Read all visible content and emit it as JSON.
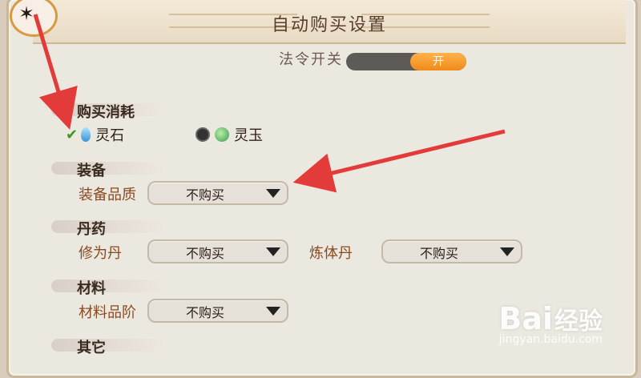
{
  "window": {
    "title": "自动购买设置"
  },
  "hidden_row": {
    "label": "法令开关",
    "toggle_text": "开"
  },
  "sections": {
    "consume": {
      "label": "购买消耗"
    },
    "equipment": {
      "label": "装备"
    },
    "pill": {
      "label": "丹药"
    },
    "material": {
      "label": "材料"
    },
    "other": {
      "label": "其它"
    }
  },
  "consume_options": [
    {
      "label": "灵石",
      "selected": true
    },
    {
      "label": "灵玉",
      "selected": false
    }
  ],
  "fields": {
    "equip_quality": {
      "label": "装备品质",
      "value": "不购买"
    },
    "xiuwei_dan": {
      "label": "修为丹",
      "value": "不购买"
    },
    "lianti_dan": {
      "label": "炼体丹",
      "value": "不购买"
    },
    "material_rank": {
      "label": "材料品阶",
      "value": "不购买"
    }
  },
  "watermark": {
    "brand": "Bai",
    "brand2": "经验",
    "sub": "jingyan.baidu.com"
  },
  "colors": {
    "accent_red": "#e33a3a",
    "toggle_orange": "#f08a1a",
    "label_brown": "#8a4a20"
  }
}
